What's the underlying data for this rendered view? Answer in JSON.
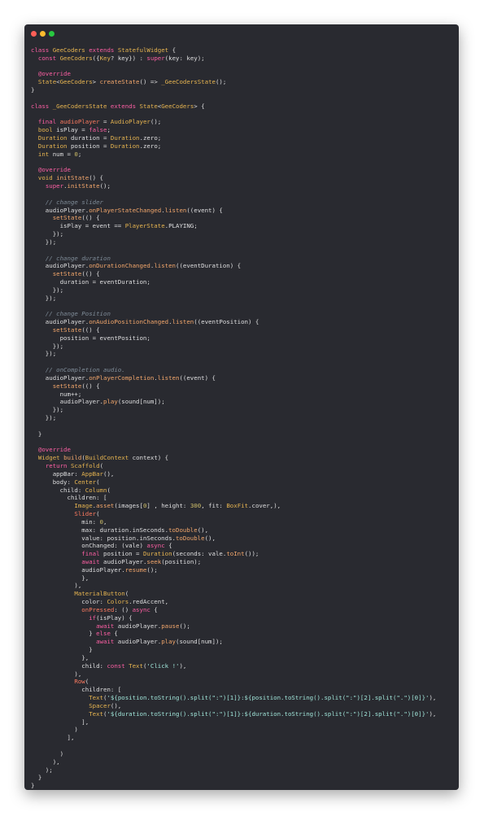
{
  "window": {
    "controls": [
      "close",
      "minimize",
      "maximize"
    ],
    "colors": {
      "close": "#ff5f57",
      "minimize": "#febc2e",
      "maximize": "#28c840",
      "background": "#292a30"
    }
  },
  "code_lines": [
    [
      [
        "kw",
        "class "
      ],
      [
        "ty",
        "GeeCoders "
      ],
      [
        "kw",
        "extends "
      ],
      [
        "ty",
        "StatefulWidget "
      ],
      [
        "tx",
        "{"
      ]
    ],
    [
      [
        "tx",
        "  "
      ],
      [
        "kw",
        "const "
      ],
      [
        "ty",
        "GeeCoders"
      ],
      [
        "tx",
        "({"
      ],
      [
        "ty",
        "Key"
      ],
      [
        "tx",
        "? key}) : "
      ],
      [
        "kw",
        "super"
      ],
      [
        "tx",
        "(key: key);"
      ]
    ],
    [],
    [
      [
        "tx",
        "  "
      ],
      [
        "kw",
        "@override"
      ]
    ],
    [
      [
        "tx",
        "  "
      ],
      [
        "ty",
        "State"
      ],
      [
        "tx",
        "<"
      ],
      [
        "ty",
        "GeeCoders"
      ],
      [
        "tx",
        "> "
      ],
      [
        "fn",
        "createState"
      ],
      [
        "tx",
        "() => "
      ],
      [
        "ty",
        "_GeeCodersState"
      ],
      [
        "tx",
        "();"
      ]
    ],
    [
      [
        "tx",
        "}"
      ]
    ],
    [],
    [
      [
        "kw",
        "class "
      ],
      [
        "ty",
        "_GeeCodersState "
      ],
      [
        "kw",
        "extends "
      ],
      [
        "ty",
        "State"
      ],
      [
        "tx",
        "<"
      ],
      [
        "ty",
        "GeeCoders"
      ],
      [
        "tx",
        "> {"
      ]
    ],
    [],
    [
      [
        "tx",
        "  "
      ],
      [
        "kw",
        "final "
      ],
      [
        "var",
        "audioPlayer"
      ],
      [
        "tx",
        " = "
      ],
      [
        "ty",
        "AudioPlayer"
      ],
      [
        "tx",
        "();"
      ]
    ],
    [
      [
        "tx",
        "  "
      ],
      [
        "ty",
        "bool "
      ],
      [
        "tx",
        "isPlay = "
      ],
      [
        "kw",
        "false"
      ],
      [
        "tx",
        ";"
      ]
    ],
    [
      [
        "tx",
        "  "
      ],
      [
        "ty",
        "Duration "
      ],
      [
        "tx",
        "duration = "
      ],
      [
        "ty",
        "Duration"
      ],
      [
        "tx",
        ".zero;"
      ]
    ],
    [
      [
        "tx",
        "  "
      ],
      [
        "ty",
        "Duration "
      ],
      [
        "tx",
        "position = "
      ],
      [
        "ty",
        "Duration"
      ],
      [
        "tx",
        ".zero;"
      ]
    ],
    [
      [
        "tx",
        "  "
      ],
      [
        "ty",
        "int "
      ],
      [
        "tx",
        "num = "
      ],
      [
        "nu",
        "0"
      ],
      [
        "tx",
        ";"
      ]
    ],
    [],
    [
      [
        "tx",
        "  "
      ],
      [
        "kw",
        "@override"
      ]
    ],
    [
      [
        "tx",
        "  "
      ],
      [
        "ty",
        "void "
      ],
      [
        "fn",
        "initState"
      ],
      [
        "tx",
        "() {"
      ]
    ],
    [
      [
        "tx",
        "    "
      ],
      [
        "kw",
        "super"
      ],
      [
        "tx",
        "."
      ],
      [
        "fn",
        "initState"
      ],
      [
        "tx",
        "();"
      ]
    ],
    [],
    [
      [
        "tx",
        "    "
      ],
      [
        "cm",
        "// change slider"
      ]
    ],
    [
      [
        "tx",
        "    audioPlayer."
      ],
      [
        "fn",
        "onPlayerStateChanged"
      ],
      [
        "tx",
        "."
      ],
      [
        "fn",
        "listen"
      ],
      [
        "tx",
        "((event) {"
      ]
    ],
    [
      [
        "tx",
        "      "
      ],
      [
        "fn",
        "setState"
      ],
      [
        "tx",
        "(() {"
      ]
    ],
    [
      [
        "tx",
        "        isPlay = event == "
      ],
      [
        "ty",
        "PlayerState"
      ],
      [
        "tx",
        ".PLAYING;"
      ]
    ],
    [
      [
        "tx",
        "      });"
      ]
    ],
    [
      [
        "tx",
        "    });"
      ]
    ],
    [],
    [
      [
        "tx",
        "    "
      ],
      [
        "cm",
        "// change duration"
      ]
    ],
    [
      [
        "tx",
        "    audioPlayer."
      ],
      [
        "fn",
        "onDurationChanged"
      ],
      [
        "tx",
        "."
      ],
      [
        "fn",
        "listen"
      ],
      [
        "tx",
        "((eventDuration) {"
      ]
    ],
    [
      [
        "tx",
        "      "
      ],
      [
        "fn",
        "setState"
      ],
      [
        "tx",
        "(() {"
      ]
    ],
    [
      [
        "tx",
        "        duration = eventDuration;"
      ]
    ],
    [
      [
        "tx",
        "      });"
      ]
    ],
    [
      [
        "tx",
        "    });"
      ]
    ],
    [],
    [
      [
        "tx",
        "    "
      ],
      [
        "cm",
        "// change Position"
      ]
    ],
    [
      [
        "tx",
        "    audioPlayer."
      ],
      [
        "fn",
        "onAudioPositionChanged"
      ],
      [
        "tx",
        "."
      ],
      [
        "fn",
        "listen"
      ],
      [
        "tx",
        "((eventPosition) {"
      ]
    ],
    [
      [
        "tx",
        "      "
      ],
      [
        "fn",
        "setState"
      ],
      [
        "tx",
        "(() {"
      ]
    ],
    [
      [
        "tx",
        "        position = eventPosition;"
      ]
    ],
    [
      [
        "tx",
        "      });"
      ]
    ],
    [
      [
        "tx",
        "    });"
      ]
    ],
    [],
    [
      [
        "tx",
        "    "
      ],
      [
        "cm",
        "// onCompletion audio."
      ]
    ],
    [
      [
        "tx",
        "    audioPlayer."
      ],
      [
        "fn",
        "onPlayerCompletion"
      ],
      [
        "tx",
        "."
      ],
      [
        "fn",
        "listen"
      ],
      [
        "tx",
        "((event) {"
      ]
    ],
    [
      [
        "tx",
        "      "
      ],
      [
        "fn",
        "setState"
      ],
      [
        "tx",
        "(() {"
      ]
    ],
    [
      [
        "tx",
        "        num++;"
      ]
    ],
    [
      [
        "tx",
        "        audioPlayer."
      ],
      [
        "fn",
        "play"
      ],
      [
        "tx",
        "(sound[num]);"
      ]
    ],
    [
      [
        "tx",
        "      });"
      ]
    ],
    [
      [
        "tx",
        "    });"
      ]
    ],
    [],
    [
      [
        "tx",
        "  }"
      ]
    ],
    [],
    [
      [
        "tx",
        "  "
      ],
      [
        "kw",
        "@override"
      ]
    ],
    [
      [
        "tx",
        "  "
      ],
      [
        "ty",
        "Widget "
      ],
      [
        "fn",
        "build"
      ],
      [
        "tx",
        "("
      ],
      [
        "ty",
        "BuildContext "
      ],
      [
        "tx",
        "context) {"
      ]
    ],
    [
      [
        "tx",
        "    "
      ],
      [
        "kw",
        "return "
      ],
      [
        "ty",
        "Scaffold"
      ],
      [
        "tx",
        "("
      ]
    ],
    [
      [
        "tx",
        "      appBar: "
      ],
      [
        "ty",
        "AppBar"
      ],
      [
        "tx",
        "(),"
      ]
    ],
    [
      [
        "tx",
        "      body: "
      ],
      [
        "ty",
        "Center"
      ],
      [
        "tx",
        "("
      ]
    ],
    [
      [
        "tx",
        "        child: "
      ],
      [
        "ty",
        "Column"
      ],
      [
        "tx",
        "("
      ]
    ],
    [
      [
        "tx",
        "          children: ["
      ]
    ],
    [
      [
        "tx",
        "            "
      ],
      [
        "ty",
        "Image"
      ],
      [
        "tx",
        "."
      ],
      [
        "fn",
        "asset"
      ],
      [
        "tx",
        "(images["
      ],
      [
        "nu",
        "0"
      ],
      [
        "tx",
        "] , height: "
      ],
      [
        "nu",
        "300"
      ],
      [
        "tx",
        ", fit: "
      ],
      [
        "ty",
        "BoxFit"
      ],
      [
        "tx",
        ".cover,),"
      ]
    ],
    [
      [
        "tx",
        "            "
      ],
      [
        "var",
        "Slider"
      ],
      [
        "tx",
        "("
      ]
    ],
    [
      [
        "tx",
        "              min: "
      ],
      [
        "nu",
        "0"
      ],
      [
        "tx",
        ","
      ]
    ],
    [
      [
        "tx",
        "              max: duration.inSeconds."
      ],
      [
        "fn",
        "toDouble"
      ],
      [
        "tx",
        "(),"
      ]
    ],
    [
      [
        "tx",
        "              value: position.inSeconds."
      ],
      [
        "fn",
        "toDouble"
      ],
      [
        "tx",
        "(),"
      ]
    ],
    [
      [
        "tx",
        "              onChanged: (vale) "
      ],
      [
        "kw",
        "async "
      ],
      [
        "tx",
        "{"
      ]
    ],
    [
      [
        "tx",
        "              "
      ],
      [
        "kw",
        "final "
      ],
      [
        "tx",
        "position = "
      ],
      [
        "ty",
        "Duration"
      ],
      [
        "tx",
        "(seconds: vale."
      ],
      [
        "fn",
        "toInt"
      ],
      [
        "tx",
        "());"
      ]
    ],
    [
      [
        "tx",
        "              "
      ],
      [
        "kw",
        "await "
      ],
      [
        "tx",
        "audioPlayer."
      ],
      [
        "fn",
        "seek"
      ],
      [
        "tx",
        "(position);"
      ]
    ],
    [
      [
        "tx",
        "              audioPlayer."
      ],
      [
        "fn",
        "resume"
      ],
      [
        "tx",
        "();"
      ]
    ],
    [
      [
        "tx",
        "              },"
      ]
    ],
    [
      [
        "tx",
        "            ),"
      ]
    ],
    [
      [
        "tx",
        "            "
      ],
      [
        "ty",
        "MaterialButton"
      ],
      [
        "tx",
        "("
      ]
    ],
    [
      [
        "tx",
        "              color: "
      ],
      [
        "ty",
        "Colors"
      ],
      [
        "tx",
        ".redAccent,"
      ]
    ],
    [
      [
        "tx",
        "              "
      ],
      [
        "var",
        "onPressed"
      ],
      [
        "tx",
        ": () "
      ],
      [
        "kw",
        "async "
      ],
      [
        "tx",
        "{"
      ]
    ],
    [
      [
        "tx",
        "                "
      ],
      [
        "kw",
        "if"
      ],
      [
        "tx",
        "(isPlay) {"
      ]
    ],
    [
      [
        "tx",
        "                  "
      ],
      [
        "kw",
        "await "
      ],
      [
        "tx",
        "audioPlayer."
      ],
      [
        "fn",
        "pause"
      ],
      [
        "tx",
        "();"
      ]
    ],
    [
      [
        "tx",
        "                } "
      ],
      [
        "kw",
        "else "
      ],
      [
        "tx",
        "{"
      ]
    ],
    [
      [
        "tx",
        "                  "
      ],
      [
        "kw",
        "await "
      ],
      [
        "tx",
        "audioPlayer."
      ],
      [
        "fn",
        "play"
      ],
      [
        "tx",
        "(sound[num]);"
      ]
    ],
    [
      [
        "tx",
        "                }"
      ]
    ],
    [
      [
        "tx",
        "              },"
      ]
    ],
    [
      [
        "tx",
        "              child: "
      ],
      [
        "kw",
        "const "
      ],
      [
        "ty",
        "Text"
      ],
      [
        "tx",
        "("
      ],
      [
        "st",
        "'Click !'"
      ],
      [
        "tx",
        "),"
      ]
    ],
    [
      [
        "tx",
        "            ),"
      ]
    ],
    [
      [
        "tx",
        "            "
      ],
      [
        "var",
        "Row"
      ],
      [
        "tx",
        "("
      ]
    ],
    [
      [
        "tx",
        "              children: ["
      ]
    ],
    [
      [
        "tx",
        "                "
      ],
      [
        "ty",
        "Text"
      ],
      [
        "tx",
        "("
      ],
      [
        "st",
        "'${position.toString().split(\":\")[1]}:${position.toString().split(\":\")[2].split(\".\")[0]}'"
      ],
      [
        "tx",
        "),"
      ]
    ],
    [
      [
        "tx",
        "                "
      ],
      [
        "ty",
        "Spacer"
      ],
      [
        "tx",
        "(),"
      ]
    ],
    [
      [
        "tx",
        "                "
      ],
      [
        "ty",
        "Text"
      ],
      [
        "tx",
        "("
      ],
      [
        "st",
        "'${duration.toString().split(\":\")[1]}:${duration.toString().split(\":\")[2].split(\".\")[0]}'"
      ],
      [
        "tx",
        "),"
      ]
    ],
    [
      [
        "tx",
        "              ],"
      ]
    ],
    [
      [
        "tx",
        "            )"
      ]
    ],
    [
      [
        "tx",
        "          ],"
      ]
    ],
    [],
    [
      [
        "tx",
        "        )"
      ]
    ],
    [
      [
        "tx",
        "      ),"
      ]
    ],
    [
      [
        "tx",
        "    );"
      ]
    ],
    [
      [
        "tx",
        "  }"
      ]
    ],
    [
      [
        "tx",
        "}"
      ]
    ]
  ]
}
